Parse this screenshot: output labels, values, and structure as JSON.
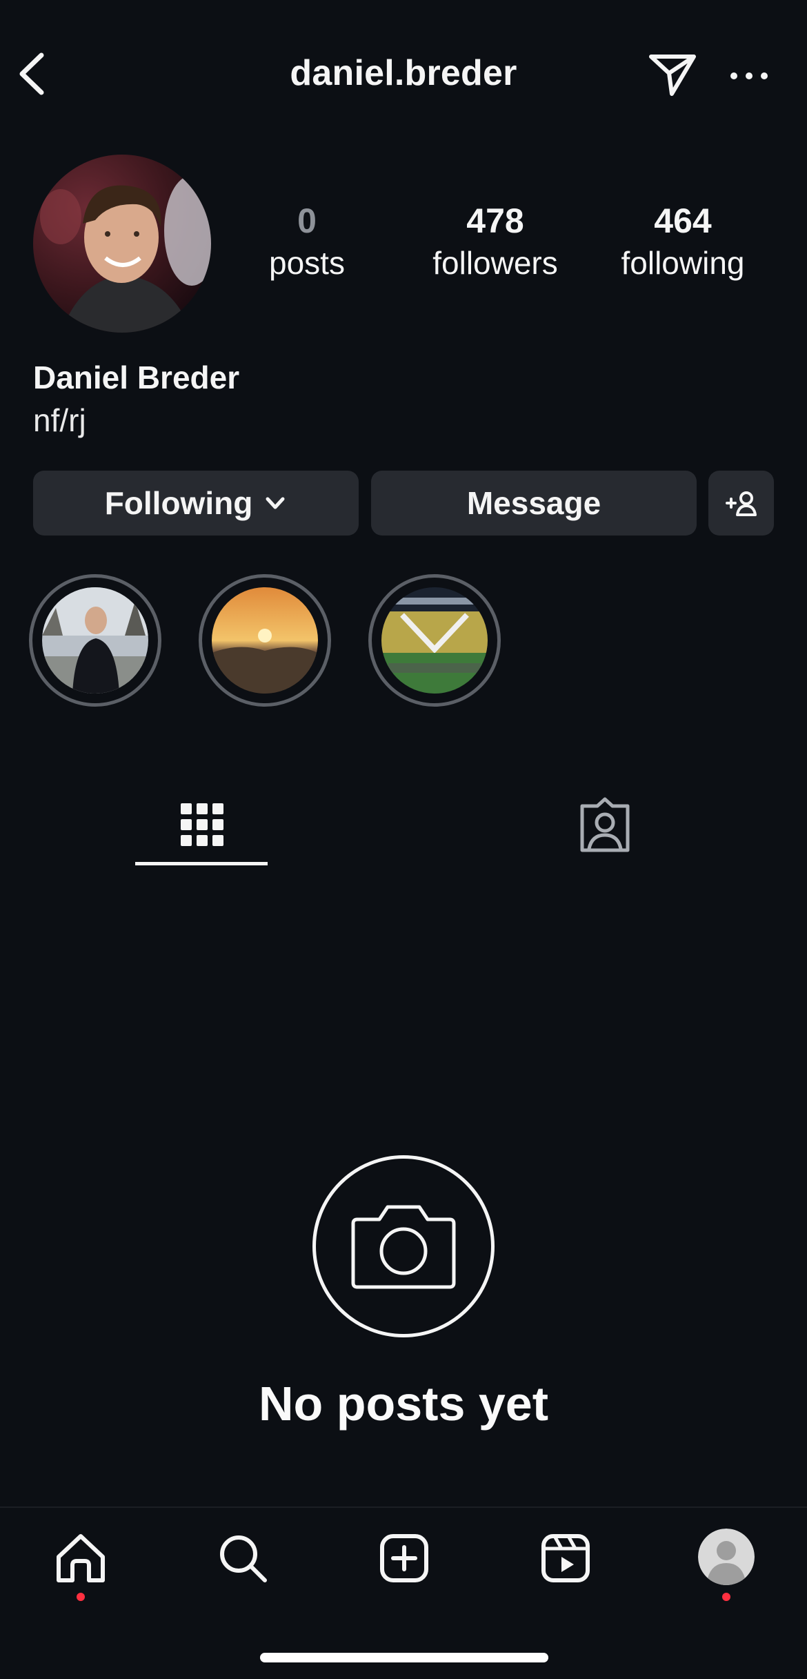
{
  "header": {
    "username": "daniel.breder",
    "back_icon": "chevron-left-icon",
    "send_icon": "paper-plane-icon",
    "more_icon": "more-horizontal-icon"
  },
  "profile": {
    "stats": {
      "posts_count": "0",
      "posts_label": "posts",
      "followers_count": "478",
      "followers_label": "followers",
      "following_count": "464",
      "following_label": "following"
    },
    "full_name": "Daniel Breder",
    "bio": "nf/rj"
  },
  "actions": {
    "following_label": "Following",
    "message_label": "Message",
    "suggest_icon": "add-person-icon"
  },
  "highlights": [
    {
      "name": "highlight-person"
    },
    {
      "name": "highlight-sunset"
    },
    {
      "name": "highlight-stadium"
    }
  ],
  "tabs": [
    {
      "name": "posts-grid",
      "icon": "grid-icon",
      "active": true
    },
    {
      "name": "tagged",
      "icon": "tagged-person-icon",
      "active": false
    }
  ],
  "empty_state": {
    "icon": "camera-icon",
    "text": "No posts yet"
  },
  "bottom_nav": [
    {
      "name": "home",
      "icon": "home-icon",
      "badge": true
    },
    {
      "name": "search",
      "icon": "search-icon",
      "badge": false
    },
    {
      "name": "create",
      "icon": "plus-square-icon",
      "badge": false
    },
    {
      "name": "reels",
      "icon": "reels-icon",
      "badge": false
    },
    {
      "name": "profile",
      "icon": "avatar-icon",
      "badge": true
    }
  ],
  "colors": {
    "background": "#0c0f14",
    "button_bg": "#272a30",
    "text": "#f5f5f5",
    "muted": "#8e9299",
    "notification_dot": "#ff3040"
  }
}
